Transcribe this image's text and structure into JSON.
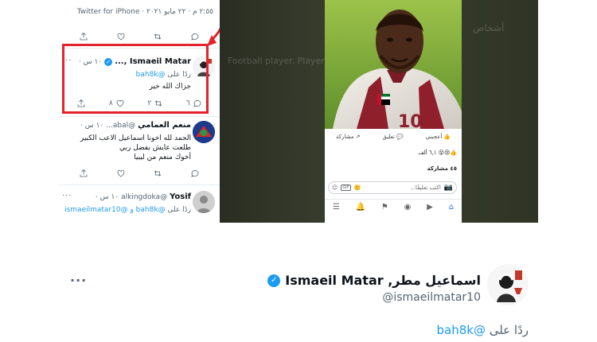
{
  "left_panel": {
    "timestamp": "٢:٥٥ م · ٢٢ مايو ٢٠٢١ · Twitter for iPhone",
    "top_actions": {
      "icons": [
        "share-icon",
        "like-icon",
        "retweet-icon",
        "reply-icon"
      ]
    },
    "tweets": [
      {
        "name": "Ismaeil Matar ,...",
        "time": "١٠ س ·",
        "verified": true,
        "reply_prefix": "ردًا على",
        "reply_mention": "@bah8k",
        "text": "جزاك الله خير",
        "counts": {
          "reply": "٦",
          "retweet": "٢",
          "like": "٨"
        }
      },
      {
        "name": "منعم العمامي",
        "handle": "@abal...",
        "time": "١٠ س ·",
        "text_lines": [
          "الحمد لله اخونا اسماعيل الاعب الكبير",
          "طلعت عايش بفضل ربي",
          "أخوك منعم من ليبيا"
        ]
      },
      {
        "name": "Yosif",
        "handle": "@alkingdoka",
        "time": "١٠ س ·",
        "reply_prefix": "ردًا على",
        "reply_mentions": "@bah8k و @ismaeilmatar10"
      }
    ]
  },
  "background_ghost": {
    "title": "أشخاص",
    "line": "Football player. Player of A Wo..."
  },
  "facebook": {
    "actions": [
      "أعجبني",
      "تعليق",
      "مشاركة"
    ],
    "reactions": "٦,١ ألف",
    "shares": "٤٥ مشاركة",
    "comment_placeholder": "اكتب تعليقًا...",
    "gif_label": "GIF",
    "accent": "#1877f2"
  },
  "bottom_tweet": {
    "display_name": "اسماعيل مطر, Ismaeil Matar",
    "handle": "@ismaeilmatar10",
    "reply_prefix": "ردًا على",
    "reply_mention": "@bah8k",
    "more": "···"
  },
  "colors": {
    "twitter_blue": "#1d9bf0",
    "highlight_red": "#e4232b",
    "muted": "#536471"
  }
}
